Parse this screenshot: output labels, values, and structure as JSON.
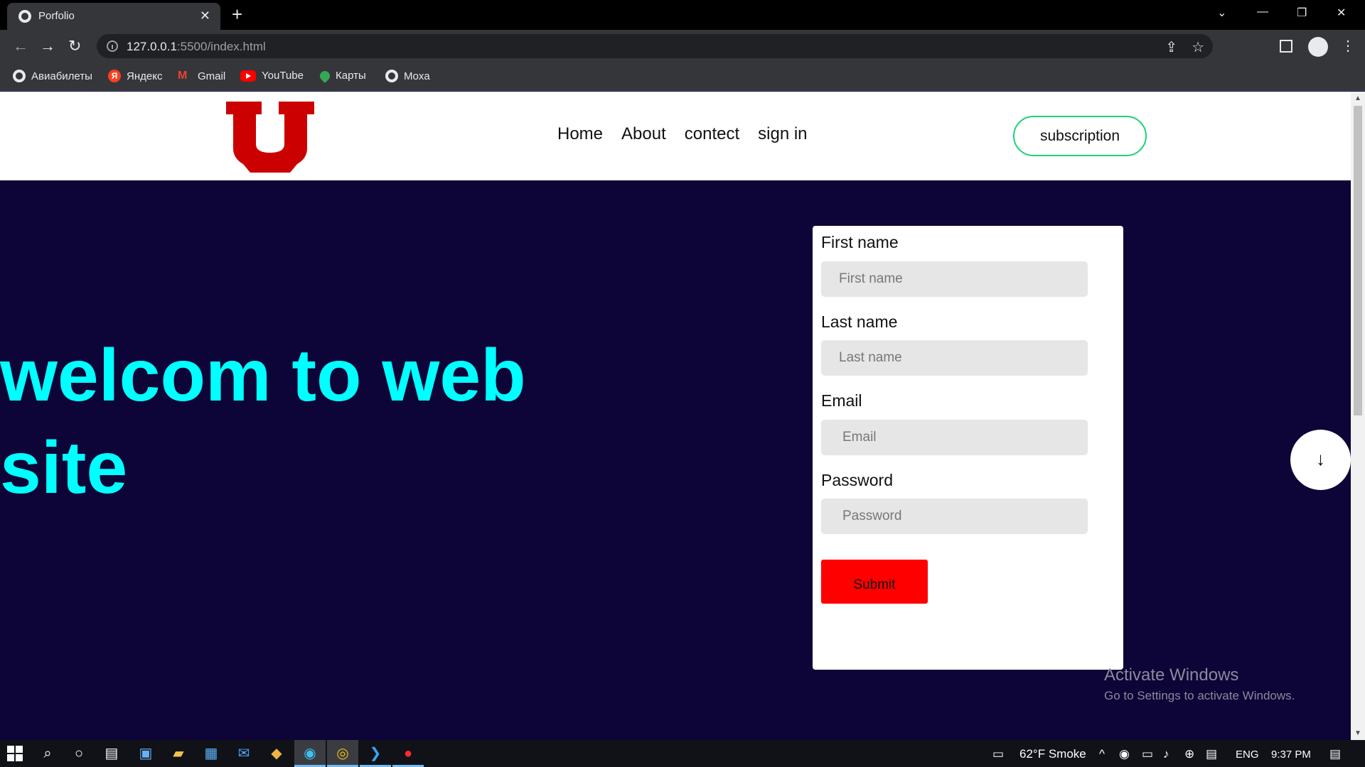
{
  "browser": {
    "tab_title": "Porfolio",
    "tab_close": "✕",
    "new_tab": "+",
    "url_host": "127.0.0.1",
    "url_rest": ":5500/index.html",
    "bookmarks": [
      {
        "label": "Авиабилеты",
        "icon": "globe-icon"
      },
      {
        "label": "Яндекс",
        "icon": "yandex-icon"
      },
      {
        "label": "Gmail",
        "icon": "gmail-icon"
      },
      {
        "label": "YouTube",
        "icon": "youtube-icon"
      },
      {
        "label": "Карты",
        "icon": "maps-icon"
      },
      {
        "label": "Moxa",
        "icon": "globe-icon"
      }
    ]
  },
  "site": {
    "nav": [
      "Home",
      "About",
      "contect",
      "sign in"
    ],
    "subscribe_label": "subscription",
    "hero_line1": "welcom to web",
    "hero_line2": "site",
    "logo_color": "#cc0000",
    "accent_color": "#00ffff",
    "background_color": "#0d0438"
  },
  "form": {
    "first_name_label": "First name",
    "first_name_placeholder": "First name",
    "last_name_label": "Last name",
    "last_name_placeholder": "Last name",
    "email_label": "Email",
    "email_placeholder": "Email",
    "password_label": "Password",
    "password_placeholder": "Password",
    "submit_label": "Submit"
  },
  "scroll_button": "↓",
  "watermark": {
    "title": "Activate Windows",
    "subtitle": "Go to Settings to activate Windows."
  },
  "taskbar": {
    "weather": "62°F Smoke",
    "language": "ENG",
    "time": "9:37 PM"
  }
}
